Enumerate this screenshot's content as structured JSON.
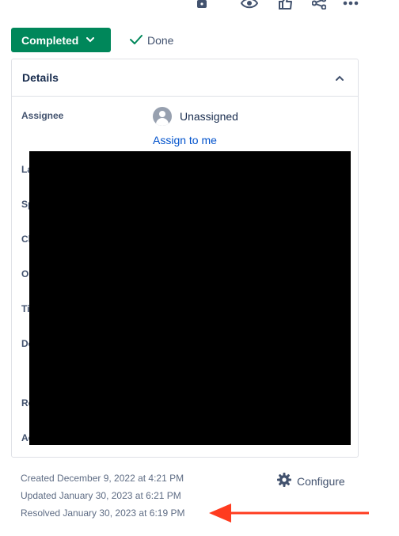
{
  "toolbar": {
    "icons": [
      "lock-icon",
      "eye-icon",
      "thumbs-up-icon",
      "share-icon",
      "more-icon"
    ]
  },
  "status": {
    "label": "Completed",
    "resolution": "Done",
    "color": "#00875a"
  },
  "details": {
    "title": "Details",
    "fields": {
      "assignee_label": "Assignee",
      "assignee_value": "Unassigned",
      "assign_link": "Assign to me"
    },
    "partial_labels": [
      "La",
      "Sp",
      "Cl",
      "Or",
      "Ti",
      "De",
      "Re",
      "Ac"
    ]
  },
  "footer": {
    "created": "Created December 9, 2022 at 4:21 PM",
    "updated": "Updated January 30, 2023 at 6:21 PM",
    "resolved": "Resolved January 30, 2023 at 6:19 PM",
    "configure_label": "Configure"
  },
  "colors": {
    "accent": "#00875a",
    "link": "#0052cc",
    "arrow": "#ff3b1f"
  }
}
